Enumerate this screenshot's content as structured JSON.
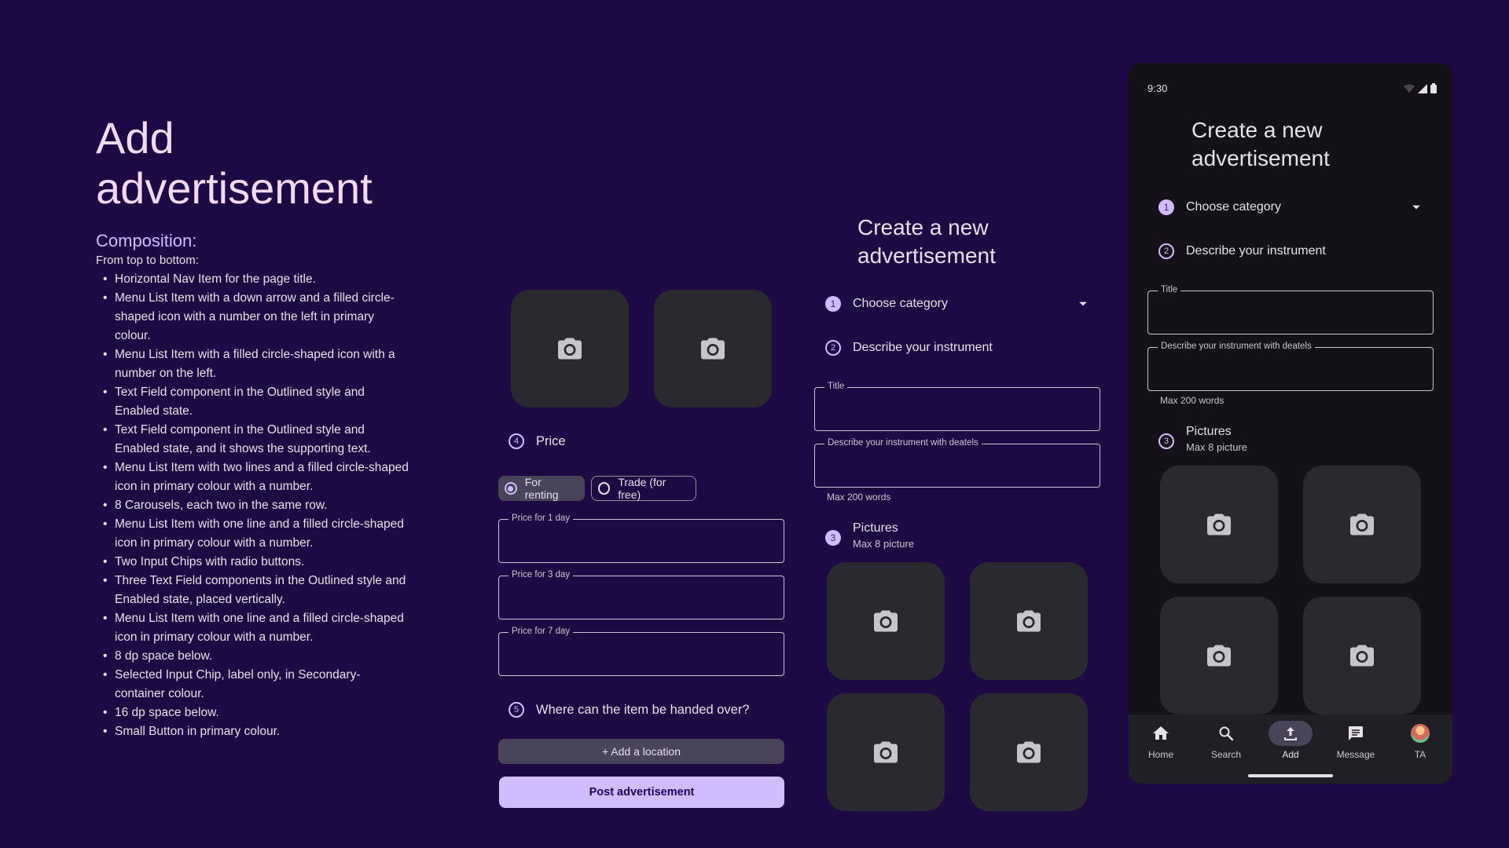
{
  "doc": {
    "title": "Add advertisement",
    "subtitle": "Composition:",
    "intro": "From top to bottom:",
    "items": [
      "Horizontal Nav Item for the page title.",
      "Menu List Item with a down arrow and a filled circle-shaped icon with a number on the left in primary colour.",
      "Menu List Item with a filled circle-shaped icon with a number on the left.",
      "Text Field component in the Outlined style and Enabled state.",
      "Text Field component in the Outlined style and Enabled state, and it shows the supporting text.",
      "Menu List Item with two lines and a filled circle-shaped icon in primary colour with a number.",
      "8 Carousels, each two in the same row.",
      "Menu List Item with one line and a filled circle-shaped icon in primary colour with a number.",
      "Two Input Chips with radio buttons.",
      "Three Text Field components in the Outlined style and Enabled state, placed vertically.",
      "Menu List Item with one line and a filled circle-shaped icon in primary colour with a number.",
      "8 dp space below.",
      "Selected Input Chip, label only, in Secondary-container colour.",
      "16 dp space below.",
      "Small Button in primary colour."
    ]
  },
  "form": {
    "title": "Create a new advertisement",
    "step1": {
      "num": "1",
      "label": "Choose category"
    },
    "step2": {
      "num": "2",
      "label": "Describe your instrument"
    },
    "title_field": "Title",
    "desc_field": "Describe your instrument with deatels",
    "desc_support": "Max 200 words",
    "step3": {
      "num": "3",
      "label": "Pictures",
      "sub": "Max 8 picture"
    },
    "step4": {
      "num": "4",
      "label": "Price"
    },
    "chip_renting": "For renting",
    "chip_trade": "Trade (for free)",
    "price1": "Price for 1 day",
    "price3": "Price for 3 day",
    "price7": "Price for 7 day",
    "step5": {
      "num": "5",
      "label": "Where can the item be handed over?"
    },
    "add_location": "+ Add a location",
    "post": "Post advertisement"
  },
  "phone": {
    "time": "9:30",
    "nav": {
      "home": "Home",
      "search": "Search",
      "add": "Add",
      "message": "Message",
      "profile": "TA"
    }
  },
  "colors": {
    "background": "#1d0a45",
    "primary": "#d0bcff",
    "surface": "#141218",
    "tile": "#2b2930",
    "secondary_container": "#4a4458"
  }
}
